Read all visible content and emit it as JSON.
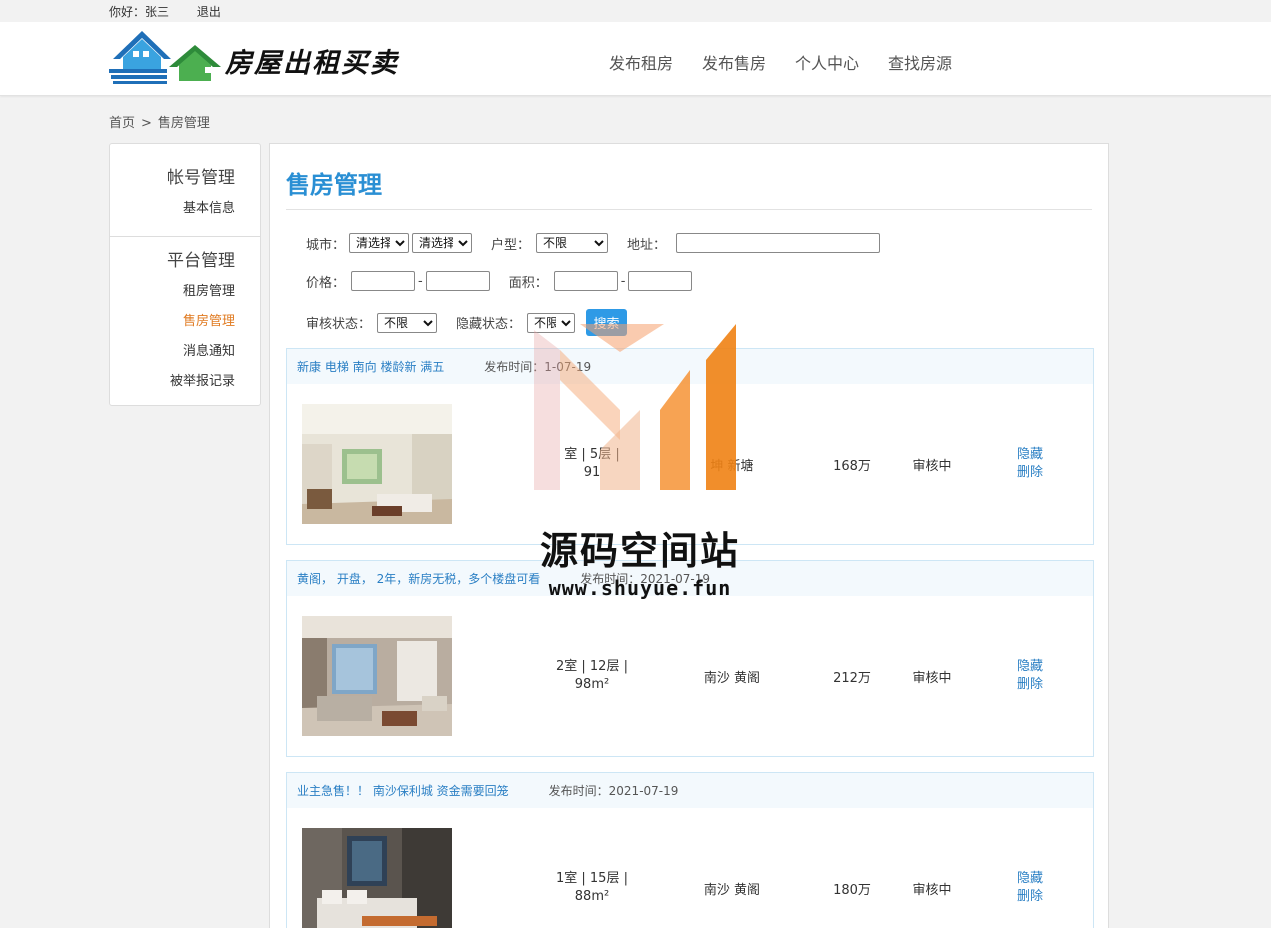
{
  "topbar": {
    "greeting": "你好：",
    "username": "张三",
    "logout": "退出"
  },
  "header": {
    "site_title": "房屋出租买卖",
    "nav": [
      "发布租房",
      "发布售房",
      "个人中心",
      "查找房源"
    ]
  },
  "breadcrumb": {
    "home": "首页",
    "separator": ">",
    "current": "售房管理"
  },
  "sidebar": {
    "account_title": "帐号管理",
    "account_items": [
      "基本信息"
    ],
    "platform_title": "平台管理",
    "platform_items": [
      "租房管理",
      "售房管理",
      "消息通知",
      "被举报记录"
    ],
    "active_item": "售房管理"
  },
  "main": {
    "title": "售房管理",
    "filters": {
      "city_label": "城市：",
      "city_select1": "清选择",
      "city_select2": "清选择",
      "type_label": "户型：",
      "type_value": "不限",
      "address_label": "地址：",
      "address_value": "",
      "price_label": "价格：",
      "price_min": "",
      "price_max": "",
      "area_label": "面积：",
      "area_min": "",
      "area_max": "",
      "range_sep": "-",
      "audit_label": "审核状态：",
      "audit_value": "不限",
      "hidden_label": "隐藏状态：",
      "hidden_value": "不限",
      "search_label": "搜索"
    },
    "date_prefix": "发布时间：",
    "listings": [
      {
        "title": "新康 电梯 南向 楼龄新 满五",
        "date": "1-07-19",
        "spec_line1": "室 | 5层 |",
        "spec_line2": "91",
        "location": "坤 新塘",
        "price": "168万",
        "status": "审核中",
        "hide": "隐藏",
        "delete": "删除"
      },
      {
        "title": "黄阁， 开盘， 2年，新房无税，多个楼盘可看",
        "date": "2021-07-19",
        "spec_line1": "2室 | 12层 |",
        "spec_line2": "98m²",
        "location": "南沙 黄阁",
        "price": "212万",
        "status": "审核中",
        "hide": "隐藏",
        "delete": "删除"
      },
      {
        "title": "业主急售！！ 南沙保利城 资金需要回笼",
        "date": "2021-07-19",
        "spec_line1": "1室 | 15层 |",
        "spec_line2": "88m²",
        "location": "南沙 黄阁",
        "price": "180万",
        "status": "审核中",
        "hide": "隐藏",
        "delete": "删除"
      }
    ]
  },
  "watermark": {
    "text": "源码空间站",
    "url": "www.shuyue.fun"
  },
  "colors": {
    "accent": "#2a8fd4",
    "active": "#e07b22",
    "link": "#2a7fc4",
    "button": "#2e9ae6"
  }
}
